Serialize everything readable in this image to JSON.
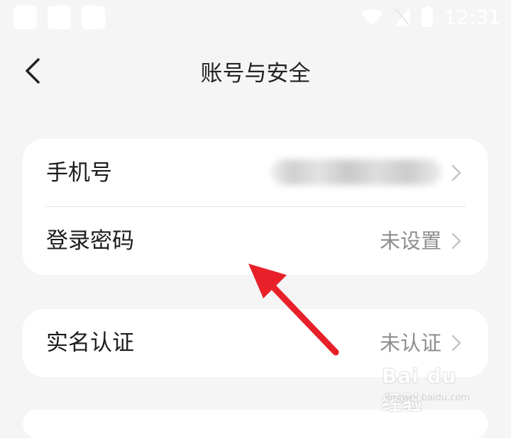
{
  "status_bar": {
    "time": "12:31"
  },
  "header": {
    "title": "账号与安全"
  },
  "account_card": {
    "phone": {
      "label": "手机号"
    },
    "password": {
      "label": "登录密码",
      "value": "未设置"
    }
  },
  "verification_card": {
    "real_name": {
      "label": "实名认证",
      "value": "未认证"
    }
  },
  "watermark": {
    "text": "Bai du 经验",
    "subtext": "jingyan.baidu.com"
  },
  "colors": {
    "background": "#f5f5f5",
    "card": "#ffffff",
    "arrow": "#e8202a",
    "muted_text": "#8e8e8e"
  },
  "icons": {
    "back": "chevron-left-icon",
    "row_action": "chevron-right-icon"
  }
}
